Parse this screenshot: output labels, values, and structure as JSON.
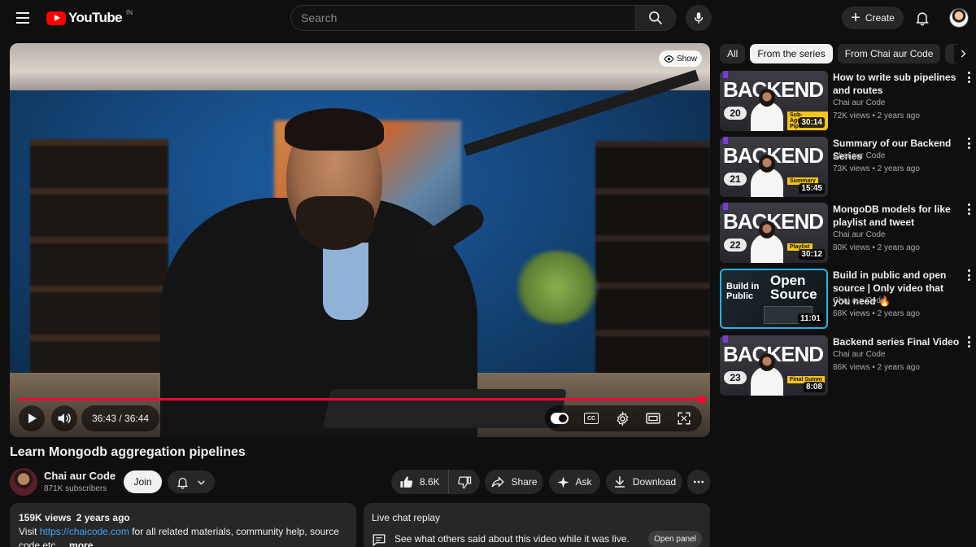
{
  "header": {
    "logo_text": "YouTube",
    "country_code": "IN",
    "search_placeholder": "Search",
    "create_label": "Create"
  },
  "player": {
    "show_label": "Show",
    "current_time": "36:43",
    "duration": "36:44",
    "time_display": "36:43 / 36:44",
    "progress_fraction": 0.9995,
    "progress_color": "#ff0033",
    "cc_label": "CC"
  },
  "video": {
    "title": "Learn Mongodb aggregation pipelines",
    "channel": "Chai aur Code",
    "subscribers": "871K subscribers",
    "join_label": "Join",
    "likes": "8.6K",
    "share_label": "Share",
    "ask_label": "Ask",
    "download_label": "Download"
  },
  "description": {
    "views": "159K views",
    "age": "2 years ago",
    "text_before_link": "Visit ",
    "link": "https://chaicode.com",
    "text_after_link": " for all related materials, community help, source code etc.",
    "more_label": "...more"
  },
  "live_chat": {
    "title": "Live chat replay",
    "text": "See what others said about this video while it was live.",
    "open_panel_label": "Open panel"
  },
  "chips": [
    {
      "label": "All",
      "active": false
    },
    {
      "label": "From the series",
      "active": true
    },
    {
      "label": "From Chai aur Code",
      "active": false
    }
  ],
  "recommendations": [
    {
      "thumb_word": "BACKEND",
      "thumb_number": "20",
      "thumb_sub": "Sub-Aggregation Pipel",
      "duration": "30:14",
      "title": "How to write sub pipelines and routes",
      "channel": "Chai aur Code",
      "meta": "72K views • 2 years ago"
    },
    {
      "thumb_word": "BACKEND",
      "thumb_number": "21",
      "thumb_sub": "Summary",
      "duration": "15:45",
      "title": "Summary of our Backend Series",
      "channel": "Chai aur Code",
      "meta": "73K views • 2 years ago"
    },
    {
      "thumb_word": "BACKEND",
      "thumb_number": "22",
      "thumb_sub": "Playlist",
      "duration": "30:12",
      "title": "MongoDB models for like playlist and tweet",
      "channel": "Chai aur Code",
      "meta": "80K views • 2 years ago"
    },
    {
      "thumb_left": "Build in Public",
      "thumb_right": "Open Source",
      "duration": "11:01",
      "title": "Build in public and open source | Only video that you need 🔥",
      "channel": "Chai aur Code",
      "meta": "68K views • 2 years ago"
    },
    {
      "thumb_word": "BACKEND",
      "thumb_number": "23",
      "thumb_sub": "Final Summ",
      "duration": "8:08",
      "title": "Backend series Final Video",
      "channel": "Chai aur Code",
      "meta": "86K views • 2 years ago"
    }
  ]
}
